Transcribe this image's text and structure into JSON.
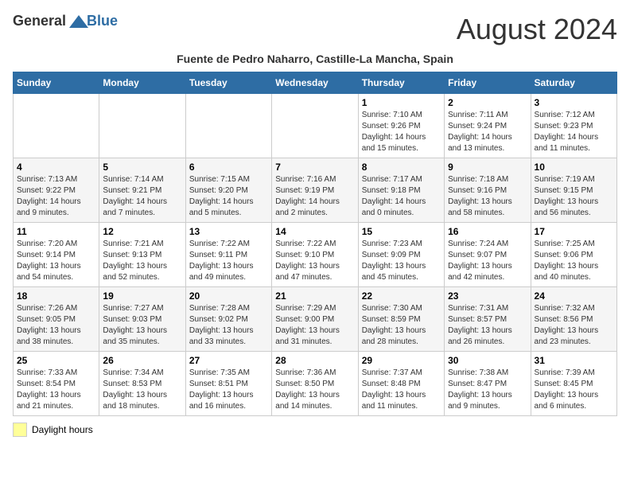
{
  "header": {
    "logo_general": "General",
    "logo_blue": "Blue",
    "month_title": "August 2024",
    "subtitle": "Fuente de Pedro Naharro, Castille-La Mancha, Spain"
  },
  "calendar": {
    "days_of_week": [
      "Sunday",
      "Monday",
      "Tuesday",
      "Wednesday",
      "Thursday",
      "Friday",
      "Saturday"
    ],
    "weeks": [
      [
        {
          "day": "",
          "info": ""
        },
        {
          "day": "",
          "info": ""
        },
        {
          "day": "",
          "info": ""
        },
        {
          "day": "",
          "info": ""
        },
        {
          "day": "1",
          "info": "Sunrise: 7:10 AM\nSunset: 9:26 PM\nDaylight: 14 hours and 15 minutes."
        },
        {
          "day": "2",
          "info": "Sunrise: 7:11 AM\nSunset: 9:24 PM\nDaylight: 14 hours and 13 minutes."
        },
        {
          "day": "3",
          "info": "Sunrise: 7:12 AM\nSunset: 9:23 PM\nDaylight: 14 hours and 11 minutes."
        }
      ],
      [
        {
          "day": "4",
          "info": "Sunrise: 7:13 AM\nSunset: 9:22 PM\nDaylight: 14 hours and 9 minutes."
        },
        {
          "day": "5",
          "info": "Sunrise: 7:14 AM\nSunset: 9:21 PM\nDaylight: 14 hours and 7 minutes."
        },
        {
          "day": "6",
          "info": "Sunrise: 7:15 AM\nSunset: 9:20 PM\nDaylight: 14 hours and 5 minutes."
        },
        {
          "day": "7",
          "info": "Sunrise: 7:16 AM\nSunset: 9:19 PM\nDaylight: 14 hours and 2 minutes."
        },
        {
          "day": "8",
          "info": "Sunrise: 7:17 AM\nSunset: 9:18 PM\nDaylight: 14 hours and 0 minutes."
        },
        {
          "day": "9",
          "info": "Sunrise: 7:18 AM\nSunset: 9:16 PM\nDaylight: 13 hours and 58 minutes."
        },
        {
          "day": "10",
          "info": "Sunrise: 7:19 AM\nSunset: 9:15 PM\nDaylight: 13 hours and 56 minutes."
        }
      ],
      [
        {
          "day": "11",
          "info": "Sunrise: 7:20 AM\nSunset: 9:14 PM\nDaylight: 13 hours and 54 minutes."
        },
        {
          "day": "12",
          "info": "Sunrise: 7:21 AM\nSunset: 9:13 PM\nDaylight: 13 hours and 52 minutes."
        },
        {
          "day": "13",
          "info": "Sunrise: 7:22 AM\nSunset: 9:11 PM\nDaylight: 13 hours and 49 minutes."
        },
        {
          "day": "14",
          "info": "Sunrise: 7:22 AM\nSunset: 9:10 PM\nDaylight: 13 hours and 47 minutes."
        },
        {
          "day": "15",
          "info": "Sunrise: 7:23 AM\nSunset: 9:09 PM\nDaylight: 13 hours and 45 minutes."
        },
        {
          "day": "16",
          "info": "Sunrise: 7:24 AM\nSunset: 9:07 PM\nDaylight: 13 hours and 42 minutes."
        },
        {
          "day": "17",
          "info": "Sunrise: 7:25 AM\nSunset: 9:06 PM\nDaylight: 13 hours and 40 minutes."
        }
      ],
      [
        {
          "day": "18",
          "info": "Sunrise: 7:26 AM\nSunset: 9:05 PM\nDaylight: 13 hours and 38 minutes."
        },
        {
          "day": "19",
          "info": "Sunrise: 7:27 AM\nSunset: 9:03 PM\nDaylight: 13 hours and 35 minutes."
        },
        {
          "day": "20",
          "info": "Sunrise: 7:28 AM\nSunset: 9:02 PM\nDaylight: 13 hours and 33 minutes."
        },
        {
          "day": "21",
          "info": "Sunrise: 7:29 AM\nSunset: 9:00 PM\nDaylight: 13 hours and 31 minutes."
        },
        {
          "day": "22",
          "info": "Sunrise: 7:30 AM\nSunset: 8:59 PM\nDaylight: 13 hours and 28 minutes."
        },
        {
          "day": "23",
          "info": "Sunrise: 7:31 AM\nSunset: 8:57 PM\nDaylight: 13 hours and 26 minutes."
        },
        {
          "day": "24",
          "info": "Sunrise: 7:32 AM\nSunset: 8:56 PM\nDaylight: 13 hours and 23 minutes."
        }
      ],
      [
        {
          "day": "25",
          "info": "Sunrise: 7:33 AM\nSunset: 8:54 PM\nDaylight: 13 hours and 21 minutes."
        },
        {
          "day": "26",
          "info": "Sunrise: 7:34 AM\nSunset: 8:53 PM\nDaylight: 13 hours and 18 minutes."
        },
        {
          "day": "27",
          "info": "Sunrise: 7:35 AM\nSunset: 8:51 PM\nDaylight: 13 hours and 16 minutes."
        },
        {
          "day": "28",
          "info": "Sunrise: 7:36 AM\nSunset: 8:50 PM\nDaylight: 13 hours and 14 minutes."
        },
        {
          "day": "29",
          "info": "Sunrise: 7:37 AM\nSunset: 8:48 PM\nDaylight: 13 hours and 11 minutes."
        },
        {
          "day": "30",
          "info": "Sunrise: 7:38 AM\nSunset: 8:47 PM\nDaylight: 13 hours and 9 minutes."
        },
        {
          "day": "31",
          "info": "Sunrise: 7:39 AM\nSunset: 8:45 PM\nDaylight: 13 hours and 6 minutes."
        }
      ]
    ]
  },
  "legend": {
    "label": "Daylight hours"
  }
}
